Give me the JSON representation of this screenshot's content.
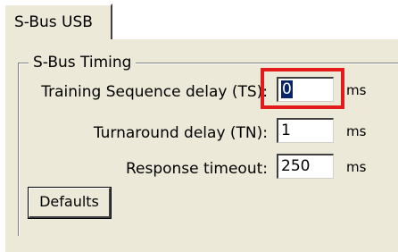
{
  "tab": {
    "label": "S-Bus USB"
  },
  "group": {
    "title": "S-Bus Timing"
  },
  "rows": [
    {
      "label": "Training Sequence delay (TS):",
      "value": "0",
      "unit": "ms"
    },
    {
      "label": "Turnaround delay (TN):",
      "value": "1",
      "unit": "ms"
    },
    {
      "label": "Response timeout:",
      "value": "250",
      "unit": "ms"
    }
  ],
  "defaults_button": {
    "label": "Defaults"
  },
  "colors": {
    "highlight": "#e41b1b",
    "selection": "#0a246a",
    "dialog_bg": "#ece9d8"
  }
}
